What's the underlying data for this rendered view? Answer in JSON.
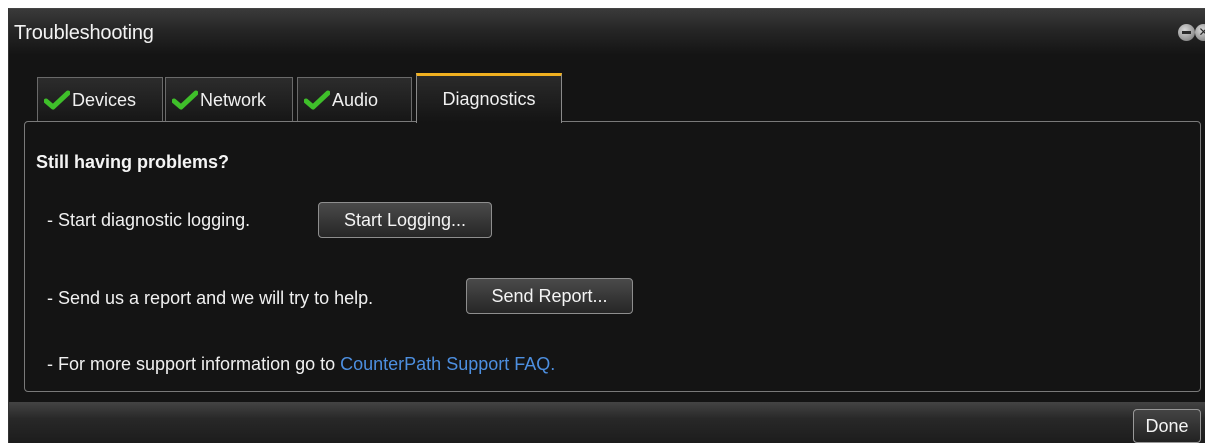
{
  "window": {
    "title": "Troubleshooting",
    "close_glyph": "✕"
  },
  "tabs": [
    {
      "label": "Devices",
      "status": "ok",
      "icon": "checkmark-icon"
    },
    {
      "label": "Network",
      "status": "ok",
      "icon": "checkmark-icon"
    },
    {
      "label": "Audio",
      "status": "ok",
      "icon": "checkmark-icon"
    },
    {
      "label": "Diagnostics",
      "active": true
    }
  ],
  "diagnostics": {
    "heading": "Still having problems?",
    "logging_text": "- Start diagnostic logging.",
    "logging_button": "Start Logging...",
    "report_text": "- Send us a report and we will try to help.",
    "report_button": "Send Report...",
    "faq_text": "- For more support information go to ",
    "faq_link": "CounterPath Support FAQ."
  },
  "footer": {
    "done_button": "Done"
  },
  "colors": {
    "active_tab_accent": "#f0b020",
    "check_green": "#3fbf2a",
    "link": "#4d8fe0"
  }
}
